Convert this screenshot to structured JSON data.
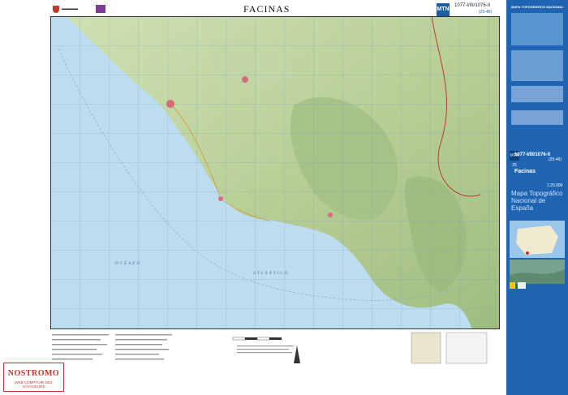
{
  "map": {
    "title": "FACINAS",
    "series_badge": "MTN 25",
    "sheet_code": "1077-I/III/1076-II",
    "sheet_code_sub": "(25-46)",
    "ocean_word_1": "OCÉANO",
    "ocean_word_2": "ATLÁNTICO",
    "colors": {
      "sea": "#bcdcef",
      "land": "#d9e8c2",
      "relief": "#a9c48a",
      "cover": "#1f64b3",
      "brand": "#c0392b"
    }
  },
  "cover": {
    "header": "MAPA TOPOGRÁFICO NACIONAL",
    "badge": "MTN 25",
    "code": "1077-I/III/1076-II",
    "code_sub": "(25-46)",
    "place": "Facinas",
    "scale": "1:25.000",
    "series_name": "Mapa Topográfico Nacional de España"
  },
  "watermark": {
    "brand": "NOSTROMO",
    "tagline": "WEB COMPTOIR DES VOYAGEURS"
  }
}
